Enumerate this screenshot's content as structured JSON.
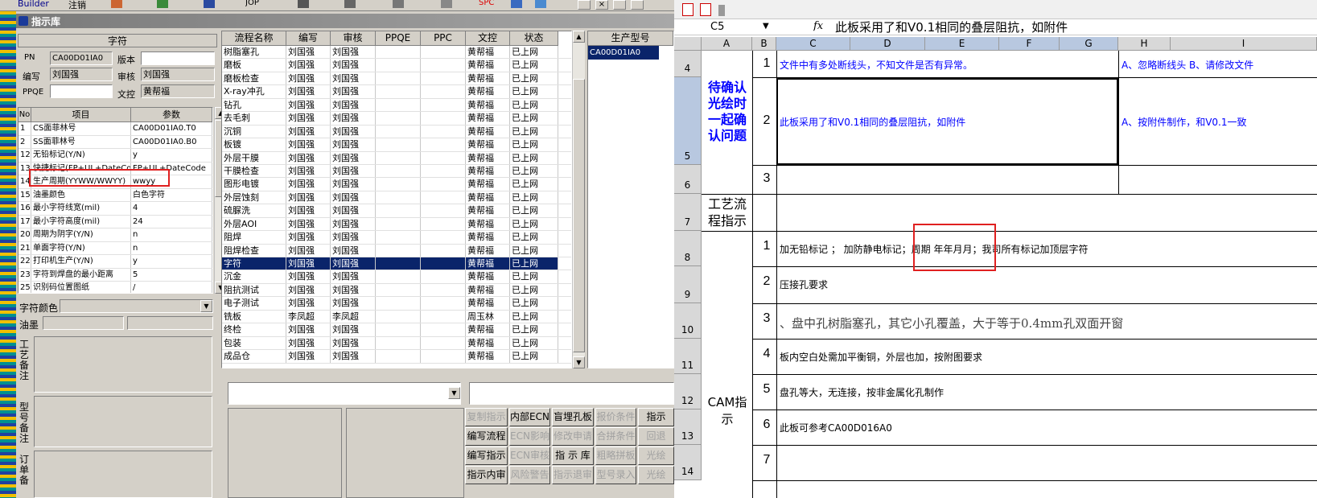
{
  "topbar": {
    "builder": "Builder",
    "logout": "注销",
    "jop": "JOP",
    "spc": "SPC"
  },
  "window": {
    "title": "指示库"
  },
  "info": {
    "header": "字符",
    "pn_label": "PN",
    "pn_value": "CA00D01IA0",
    "version_label": "版本",
    "version_value": "",
    "author_label": "编写",
    "author_value": "刘国强",
    "review_label": "审核",
    "review_value": "刘国强",
    "ppqe_label": "PPQE",
    "ppqe_value": "",
    "doc_label": "文控",
    "doc_value": "黄帮福"
  },
  "params": {
    "headers": [
      "No",
      "项目",
      "参数"
    ],
    "rows": [
      {
        "no": "1",
        "item": "CS面菲林号",
        "value": "CA00D01IA0.T0"
      },
      {
        "no": "2",
        "item": "SS面菲林号",
        "value": "CA00D01IA0.B0"
      },
      {
        "no": "12",
        "item": "无铅标记(Y/N)",
        "value": "y"
      },
      {
        "no": "13",
        "item": "快捷标记(FP+UL+DateCo",
        "value": "FP+UL+DateCode"
      },
      {
        "no": "14",
        "item": "生产周期(YYWW/WWYY)",
        "value": "wwyy"
      },
      {
        "no": "15",
        "item": "油墨颜色",
        "value": "白色字符"
      },
      {
        "no": "16",
        "item": "最小字符线宽(mil)",
        "value": "4"
      },
      {
        "no": "17",
        "item": "最小字符高度(mil)",
        "value": "24"
      },
      {
        "no": "20",
        "item": "周期为阴字(Y/N)",
        "value": "n"
      },
      {
        "no": "21",
        "item": "单面字符(Y/N)",
        "value": "n"
      },
      {
        "no": "22",
        "item": "打印机生产(Y/N)",
        "value": "y"
      },
      {
        "no": "23",
        "item": "字符到焊盘的最小距离",
        "value": "5"
      },
      {
        "no": "25",
        "item": "识别码位置图纸",
        "value": "/"
      }
    ],
    "char_color_label": "字符颜色",
    "ink_label": "油墨",
    "process_note_label": "工艺备注",
    "model_note_label": "型号备注",
    "order_note_label": "订单备"
  },
  "flow": {
    "headers": [
      "流程名称",
      "编写",
      "审核",
      "PPQE",
      "PPC",
      "文控",
      "状态"
    ],
    "rows": [
      {
        "name": "树脂塞孔",
        "author": "刘国强",
        "review": "刘国强",
        "ppqe": "",
        "ppc": "",
        "doc": "黄帮福",
        "status": "已上网"
      },
      {
        "name": "磨板",
        "author": "刘国强",
        "review": "刘国强",
        "ppqe": "",
        "ppc": "",
        "doc": "黄帮福",
        "status": "已上网"
      },
      {
        "name": "磨板检查",
        "author": "刘国强",
        "review": "刘国强",
        "ppqe": "",
        "ppc": "",
        "doc": "黄帮福",
        "status": "已上网"
      },
      {
        "name": "X-ray冲孔",
        "author": "刘国强",
        "review": "刘国强",
        "ppqe": "",
        "ppc": "",
        "doc": "黄帮福",
        "status": "已上网"
      },
      {
        "name": "钻孔",
        "author": "刘国强",
        "review": "刘国强",
        "ppqe": "",
        "ppc": "",
        "doc": "黄帮福",
        "status": "已上网"
      },
      {
        "name": "去毛刺",
        "author": "刘国强",
        "review": "刘国强",
        "ppqe": "",
        "ppc": "",
        "doc": "黄帮福",
        "status": "已上网"
      },
      {
        "name": "沉铜",
        "author": "刘国强",
        "review": "刘国强",
        "ppqe": "",
        "ppc": "",
        "doc": "黄帮福",
        "status": "已上网"
      },
      {
        "name": "板镀",
        "author": "刘国强",
        "review": "刘国强",
        "ppqe": "",
        "ppc": "",
        "doc": "黄帮福",
        "status": "已上网"
      },
      {
        "name": "外层干膜",
        "author": "刘国强",
        "review": "刘国强",
        "ppqe": "",
        "ppc": "",
        "doc": "黄帮福",
        "status": "已上网"
      },
      {
        "name": "干膜检查",
        "author": "刘国强",
        "review": "刘国强",
        "ppqe": "",
        "ppc": "",
        "doc": "黄帮福",
        "status": "已上网"
      },
      {
        "name": "图形电镀",
        "author": "刘国强",
        "review": "刘国强",
        "ppqe": "",
        "ppc": "",
        "doc": "黄帮福",
        "status": "已上网"
      },
      {
        "name": "外层蚀刻",
        "author": "刘国强",
        "review": "刘国强",
        "ppqe": "",
        "ppc": "",
        "doc": "黄帮福",
        "status": "已上网"
      },
      {
        "name": "硫脲洗",
        "author": "刘国强",
        "review": "刘国强",
        "ppqe": "",
        "ppc": "",
        "doc": "黄帮福",
        "status": "已上网"
      },
      {
        "name": "外层AOI",
        "author": "刘国强",
        "review": "刘国强",
        "ppqe": "",
        "ppc": "",
        "doc": "黄帮福",
        "status": "已上网"
      },
      {
        "name": "阻焊",
        "author": "刘国强",
        "review": "刘国强",
        "ppqe": "",
        "ppc": "",
        "doc": "黄帮福",
        "status": "已上网"
      },
      {
        "name": "阻焊检查",
        "author": "刘国强",
        "review": "刘国强",
        "ppqe": "",
        "ppc": "",
        "doc": "黄帮福",
        "status": "已上网"
      },
      {
        "name": "字符",
        "author": "刘国强",
        "review": "刘国强",
        "ppqe": "",
        "ppc": "",
        "doc": "黄帮福",
        "status": "已上网",
        "selected": true
      },
      {
        "name": "沉金",
        "author": "刘国强",
        "review": "刘国强",
        "ppqe": "",
        "ppc": "",
        "doc": "黄帮福",
        "status": "已上网"
      },
      {
        "name": "阻抗测试",
        "author": "刘国强",
        "review": "刘国强",
        "ppqe": "",
        "ppc": "",
        "doc": "黄帮福",
        "status": "已上网"
      },
      {
        "name": "电子测试",
        "author": "刘国强",
        "review": "刘国强",
        "ppqe": "",
        "ppc": "",
        "doc": "黄帮福",
        "status": "已上网"
      },
      {
        "name": "铣板",
        "author": "李凤超",
        "review": "李凤超",
        "ppqe": "",
        "ppc": "",
        "doc": "周玉林",
        "status": "已上网"
      },
      {
        "name": "终检",
        "author": "刘国强",
        "review": "刘国强",
        "ppqe": "",
        "ppc": "",
        "doc": "黄帮福",
        "status": "已上网"
      },
      {
        "name": "包装",
        "author": "刘国强",
        "review": "刘国强",
        "ppqe": "",
        "ppc": "",
        "doc": "黄帮福",
        "status": "已上网"
      },
      {
        "name": "成品仓",
        "author": "刘国强",
        "review": "刘国强",
        "ppqe": "",
        "ppc": "",
        "doc": "黄帮福",
        "status": "已上网"
      }
    ]
  },
  "models": {
    "header": "生产型号",
    "items": [
      "CA00D01IA0"
    ]
  },
  "buttons": [
    {
      "label": "复制指示",
      "enabled": false
    },
    {
      "label": "内部ECN",
      "enabled": true
    },
    {
      "label": "盲埋孔板",
      "enabled": true
    },
    {
      "label": "报价条件",
      "enabled": false
    },
    {
      "label": "指示",
      "enabled": true
    },
    {
      "label": "编写流程",
      "enabled": true
    },
    {
      "label": "ECN影响",
      "enabled": false
    },
    {
      "label": "修改申请",
      "enabled": false
    },
    {
      "label": "合拼条件",
      "enabled": false
    },
    {
      "label": "回退",
      "enabled": false
    },
    {
      "label": "编写指示",
      "enabled": true
    },
    {
      "label": "ECN审核",
      "enabled": false
    },
    {
      "label": "指 示 库",
      "enabled": true
    },
    {
      "label": "粗略拼板",
      "enabled": false
    },
    {
      "label": "光绘",
      "enabled": false
    },
    {
      "label": "指示内审",
      "enabled": true
    },
    {
      "label": "风险警告",
      "enabled": false
    },
    {
      "label": "指示退审",
      "enabled": false
    },
    {
      "label": "型号录入",
      "enabled": false
    },
    {
      "label": "光绘",
      "enabled": false
    }
  ],
  "excel": {
    "cell_ref": "C5",
    "fx": "fx",
    "formula": "此板采用了和V0.1相同的叠层阻抗，如附件",
    "columns": [
      "A",
      "B",
      "C",
      "D",
      "E",
      "F",
      "G",
      "H",
      "I"
    ],
    "rows": [
      "4",
      "5",
      "6",
      "7",
      "8",
      "9",
      "10",
      "11",
      "12",
      "13",
      "14"
    ],
    "section_confirm": "待确认光绘时一起确认问题",
    "section_process": "工艺流程指示",
    "section_cam": "CAM指示",
    "confirm_items": [
      {
        "num": "1",
        "text": "文件中有多处断线头，不知文件是否有异常。",
        "answer": "A、忽略断线头 B、请修改文件"
      },
      {
        "num": "2",
        "text": "此板采用了和V0.1相同的叠层阻抗，如附件",
        "answer": "A、按附件制作，和V0.1一致"
      },
      {
        "num": "3",
        "text": "",
        "answer": ""
      }
    ],
    "cam_items": [
      {
        "num": "1",
        "text": "加无铅标记 ； 加防静电标记；周期 年年月月；我司所有标记加顶层字符"
      },
      {
        "num": "2",
        "text": "压接孔要求"
      },
      {
        "num": "3",
        "text": "、盘中孔树脂塞孔，其它小孔覆盖，大于等于0.4mm孔双面开窗"
      },
      {
        "num": "4",
        "text": "板内空白处需加平衡铜，外层也加，按附图要求"
      },
      {
        "num": "5",
        "text": "盘孔等大，无连接，按非金属化孔制作"
      },
      {
        "num": "6",
        "text": "此板可参考CA00D016A0"
      },
      {
        "num": "7",
        "text": ""
      }
    ]
  },
  "colors": {
    "selection": "#0a246a",
    "highlight": "#e02020",
    "link_blue": "#0000ff"
  }
}
